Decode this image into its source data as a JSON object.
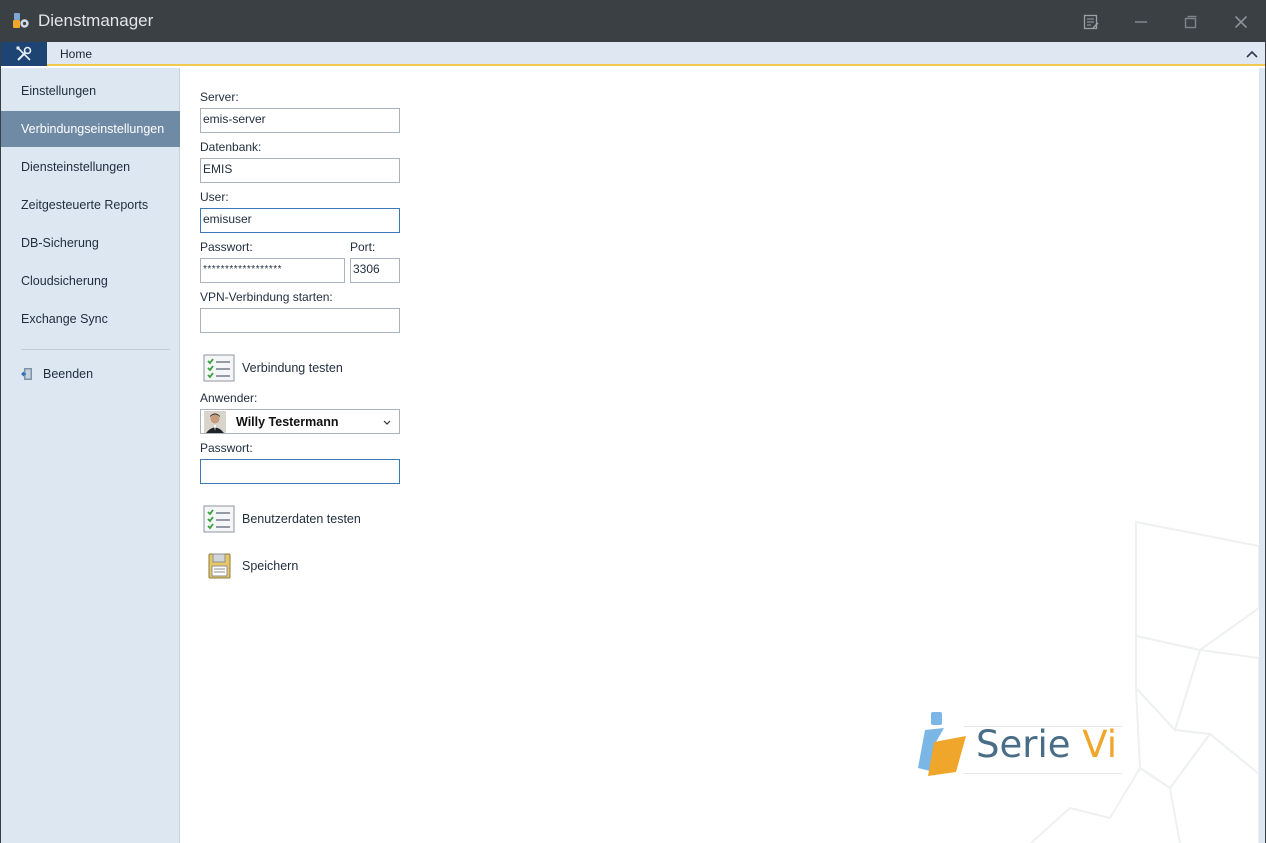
{
  "window": {
    "title": "Dienstmanager"
  },
  "ribbon": {
    "tabs": [
      {
        "label": "Home"
      }
    ]
  },
  "sidebar": {
    "items": [
      {
        "label": "Einstellungen",
        "active": false
      },
      {
        "label": "Verbindungseinstellungen",
        "active": true
      },
      {
        "label": "Diensteinstellungen",
        "active": false
      },
      {
        "label": "Zeitgesteuerte Reports",
        "active": false
      },
      {
        "label": "DB-Sicherung",
        "active": false
      },
      {
        "label": "Cloudsicherung",
        "active": false
      },
      {
        "label": "Exchange Sync",
        "active": false
      }
    ],
    "quit_label": "Beenden"
  },
  "form": {
    "server": {
      "label": "Server:",
      "value": "emis-server"
    },
    "database": {
      "label": "Datenbank:",
      "value": "EMIS"
    },
    "user": {
      "label": "User:",
      "value": "emisuser"
    },
    "password": {
      "label": "Passwort:",
      "value": "******************"
    },
    "port": {
      "label": "Port:",
      "value": "3306"
    },
    "vpn": {
      "label": "VPN-Verbindung starten:",
      "value": ""
    },
    "test_connection_label": "Verbindung testen",
    "user_select": {
      "label": "Anwender:",
      "value": "Willy Testermann"
    },
    "user_password": {
      "label": "Passwort:",
      "value": ""
    },
    "test_user_label": "Benutzerdaten testen",
    "save_label": "Speichern"
  },
  "branding": {
    "part1": "Serie ",
    "part2": "Vi"
  },
  "colors": {
    "titlebar": "#3b4045",
    "nav_active": "#6f8aa5",
    "sidebar_bg": "#dde7f2",
    "accent_orange": "#f0a52b",
    "accent_blue": "#4a6d87"
  }
}
